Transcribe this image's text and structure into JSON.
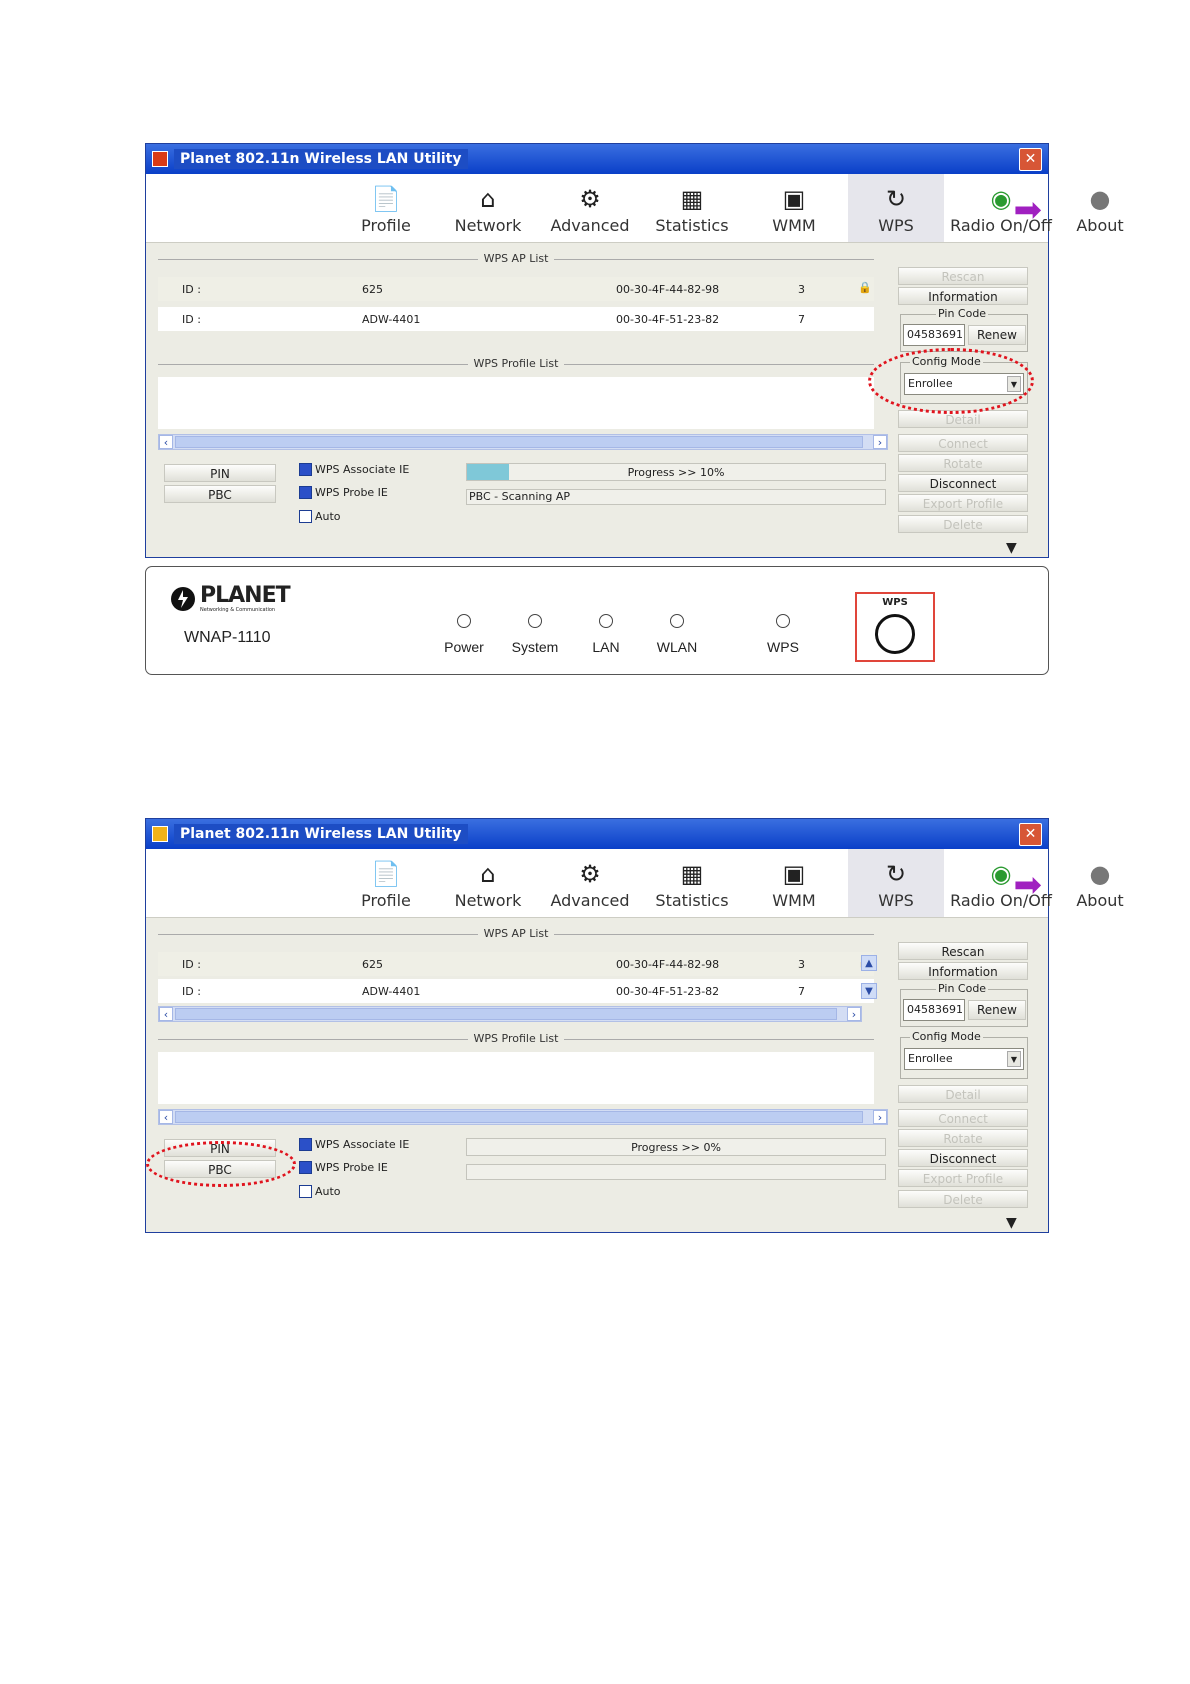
{
  "window_title": "Planet 802.11n Wireless LAN Utility",
  "toolbar": [
    "Profile",
    "Network",
    "Advanced",
    "Statistics",
    "WMM",
    "WPS",
    "Radio On/Off",
    "About"
  ],
  "sections": {
    "ap_list": "WPS AP List",
    "profile_list": "WPS Profile List"
  },
  "ap_rows": [
    {
      "id_label": "ID :",
      "name": "625",
      "mac": "00-30-4F-44-82-98",
      "channel": "3"
    },
    {
      "id_label": "ID :",
      "name": "ADW-4401",
      "mac": "00-30-4F-51-23-82",
      "channel": "7"
    }
  ],
  "buttons": {
    "pin": "PIN",
    "pbc": "PBC"
  },
  "checks": {
    "assoc": "WPS Associate IE",
    "probe": "WPS Probe IE",
    "auto": "Auto"
  },
  "right_panel": {
    "rescan": "Rescan",
    "information": "Information",
    "pin_code_title": "Pin Code",
    "pin_code": "04583691",
    "renew": "Renew",
    "config_mode_title": "Config Mode",
    "config_mode": "Enrollee",
    "detail": "Detail",
    "connect": "Connect",
    "rotate": "Rotate",
    "disconnect": "Disconnect",
    "export_profile": "Export Profile",
    "delete": "Delete"
  },
  "screen1": {
    "progress_text": "Progress >> 10%",
    "progress_value": 0.1,
    "status": "PBC - Scanning AP"
  },
  "screen2": {
    "progress_text": "Progress >> 0%",
    "progress_value": 0.0,
    "status": ""
  },
  "device": {
    "brand": "PLANET",
    "tagline": "Networking & Communication",
    "model": "WNAP-1110",
    "leds": [
      "Power",
      "System",
      "LAN",
      "WLAN",
      "WPS"
    ],
    "wps_button_label": "WPS"
  },
  "colors": {
    "highlight": "#e0141e",
    "titlebar": "#0a3fc8",
    "progress_fill": "#7fc8d8"
  }
}
